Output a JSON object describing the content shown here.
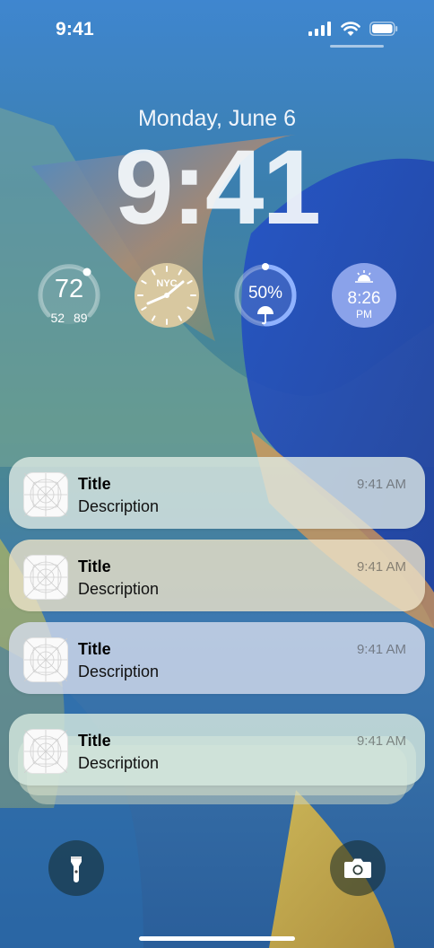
{
  "status_bar": {
    "time": "9:41"
  },
  "lock_screen": {
    "date": "Monday, June 6",
    "clock": "9:41"
  },
  "widgets": {
    "temperature": {
      "value": "72",
      "low": "52",
      "high": "89"
    },
    "world_clock": {
      "city": "NYC"
    },
    "rain": {
      "value": "50%",
      "level": 0.5
    },
    "sunrise": {
      "time": "8:26",
      "period": "PM"
    }
  },
  "notifications": [
    {
      "title": "Title",
      "description": "Description",
      "time": "9:41 AM"
    },
    {
      "title": "Title",
      "description": "Description",
      "time": "9:41 AM"
    },
    {
      "title": "Title",
      "description": "Description",
      "time": "9:41 AM"
    },
    {
      "title": "Title",
      "description": "Description",
      "time": "9:41 AM"
    }
  ],
  "quick_actions": {
    "left": "flashlight-icon",
    "right": "camera-icon"
  },
  "colors": {
    "accent": "#8aa2ea",
    "text": "#ffffff"
  }
}
